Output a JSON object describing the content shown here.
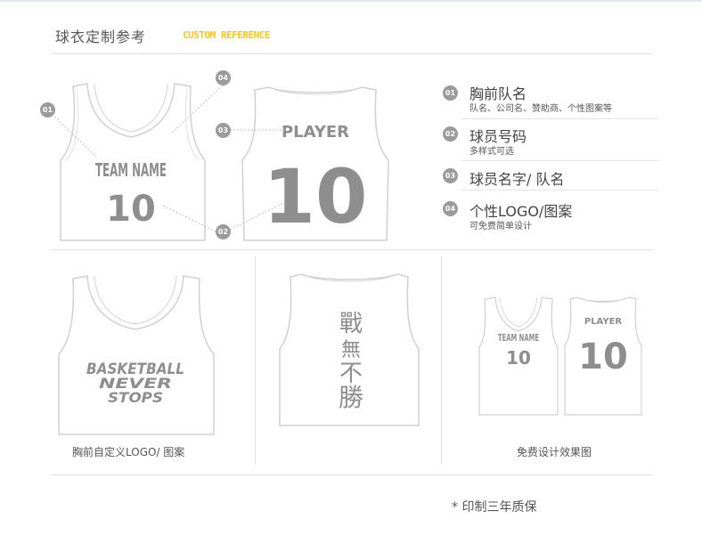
{
  "header": {
    "title": "球衣定制参考",
    "subtitle": "CUSTOM REFERENCE"
  },
  "colors": {
    "accent": "#f2c719",
    "badge": "#9b9b9b",
    "print": "#8e8e8e"
  },
  "diagram": {
    "front": {
      "team_name": "TEAM NAME",
      "number": "10"
    },
    "back": {
      "player": "PLAYER",
      "number": "10"
    },
    "badges": {
      "b01": "01",
      "b02": "02",
      "b03": "03",
      "b04": "04"
    }
  },
  "features": [
    {
      "num": "01",
      "title": "胸前队名",
      "desc": "队名、公司名、赞助商、个性图案等"
    },
    {
      "num": "02",
      "title": "球员号码",
      "desc": "多样式可选"
    },
    {
      "num": "03",
      "title": "球员名字/ 队名",
      "desc": ""
    },
    {
      "num": "04",
      "title": "个性LOGO/图案",
      "desc": "可免费简单设计"
    }
  ],
  "gallery": {
    "logo": {
      "line1": "BASKETBALL",
      "line2": "NEVER",
      "line3": "STOPS",
      "caption": "胸前自定义LOGO/ 图案"
    },
    "calligraphy": {
      "chars": [
        "戰",
        "無",
        "不",
        "勝"
      ]
    },
    "preview": {
      "team_name": "TEAM NAME",
      "number_front": "10",
      "player": "PLAYER",
      "number_back": "10",
      "caption": "免费设计效果图"
    }
  },
  "warranty": "* 印制三年质保"
}
